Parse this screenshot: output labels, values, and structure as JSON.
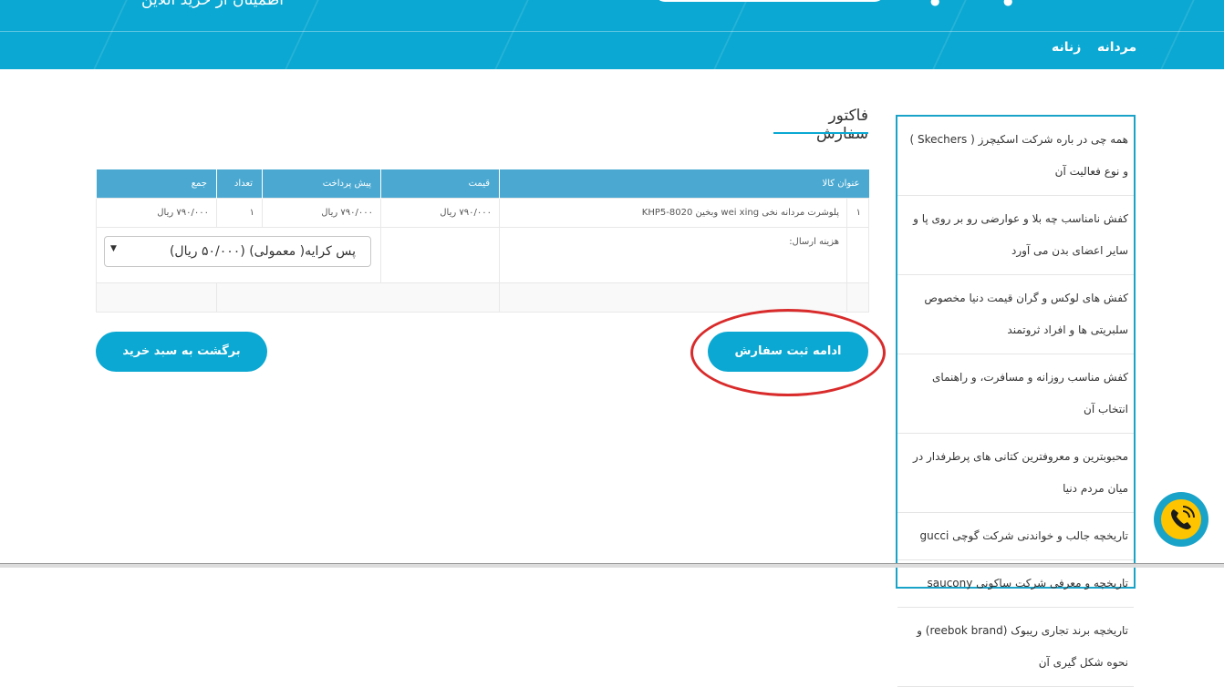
{
  "header": {
    "tagline": "اطمینان از خرید آنلاین",
    "nav": [
      {
        "label": "مردانه"
      },
      {
        "label": "زنانه"
      }
    ]
  },
  "invoice": {
    "title": "فاکتور سفارش",
    "columns": [
      "عنوان کالا",
      "قیمت",
      "پیش پرداخت",
      "تعداد",
      "جمع"
    ],
    "rows": [
      {
        "index": "۱",
        "title": "پلوشرت مردانه نخی wei xing وبخین KHP5-8020",
        "price": "۷۹۰/۰۰۰ ریال",
        "prepay": "۷۹۰/۰۰۰ ریال",
        "qty": "۱",
        "sum": "۷۹۰/۰۰۰ ریال"
      }
    ],
    "shipping_label": "هزینه ارسال:",
    "shipping_select": {
      "selected": "پس کرایه( معمولی) (۵۰/۰۰۰ ریال)"
    },
    "continue_button": "ادامه ثبت سفارش",
    "back_button": "برگشت به سبد خرید"
  },
  "sidebar": {
    "items": [
      {
        "label": "همه چی در باره شرکت اسکیچرز ( Skechers ) و نوع فعالیت آن"
      },
      {
        "label": "کفش نامناسب چه بلا و عوارضی رو بر روی پا و سایر اعضای بدن می آورد"
      },
      {
        "label": "کفش های لوکس و گران قیمت دنیا مخصوص سلبریتی ها و افراد ثروتمند"
      },
      {
        "label": "کفش مناسب روزانه و مسافرت، و راهنمای انتخاب آن"
      },
      {
        "label": "محبوبترین و معروفترین کتانی های پرطرفدار در میان مردم دنیا"
      },
      {
        "label": "تاریخچه جالب و خواندنی شرکت گوچی gucci"
      },
      {
        "label": "تاریخچه و معرفی شرکت ساکونی saucony"
      },
      {
        "label": "تاریخچه برند تجاری ریبوک (reebok brand) و نحوه شکل گیری آن"
      }
    ]
  },
  "icons": {
    "phone": "phone-call-icon",
    "select_arrow": "▼"
  },
  "colors": {
    "brand": "#0aa8d2",
    "table_header": "#4ba9d1",
    "highlight": "#d92b2b",
    "phone_inner": "#ffc400"
  }
}
